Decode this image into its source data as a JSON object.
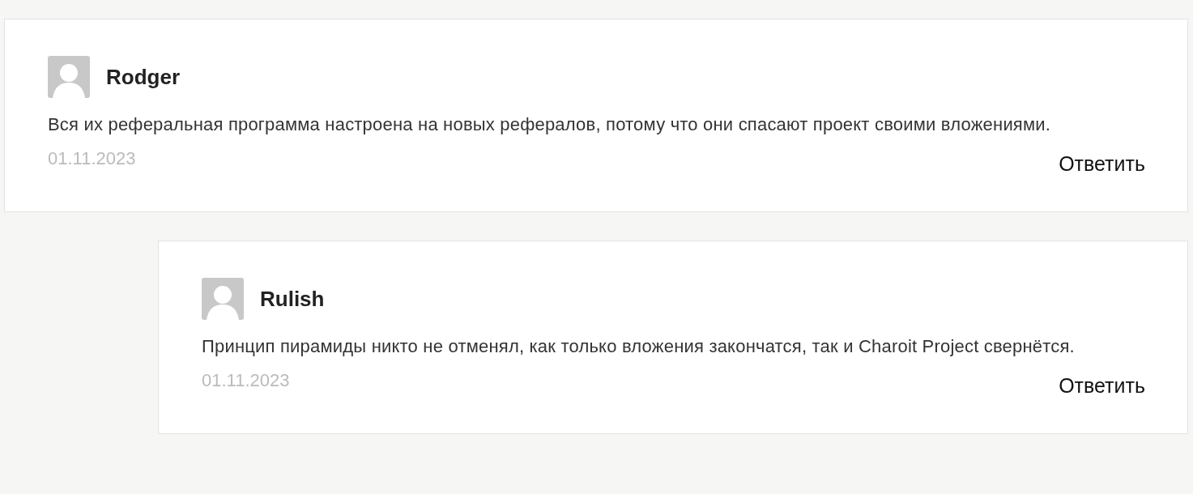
{
  "comments": [
    {
      "author": "Rodger",
      "text": "Вся их реферальная программа настроена на новых рефералов, потому что они спасают проект своими вложениями.",
      "date": "01.11.2023",
      "reply": "Ответить",
      "children": [
        {
          "author": "Rulish",
          "text": "Принцип пирамиды никто не отменял, как только вложения закончатся, так и Charoit Project свернётся.",
          "date": "01.11.2023",
          "reply": "Ответить"
        }
      ]
    }
  ]
}
